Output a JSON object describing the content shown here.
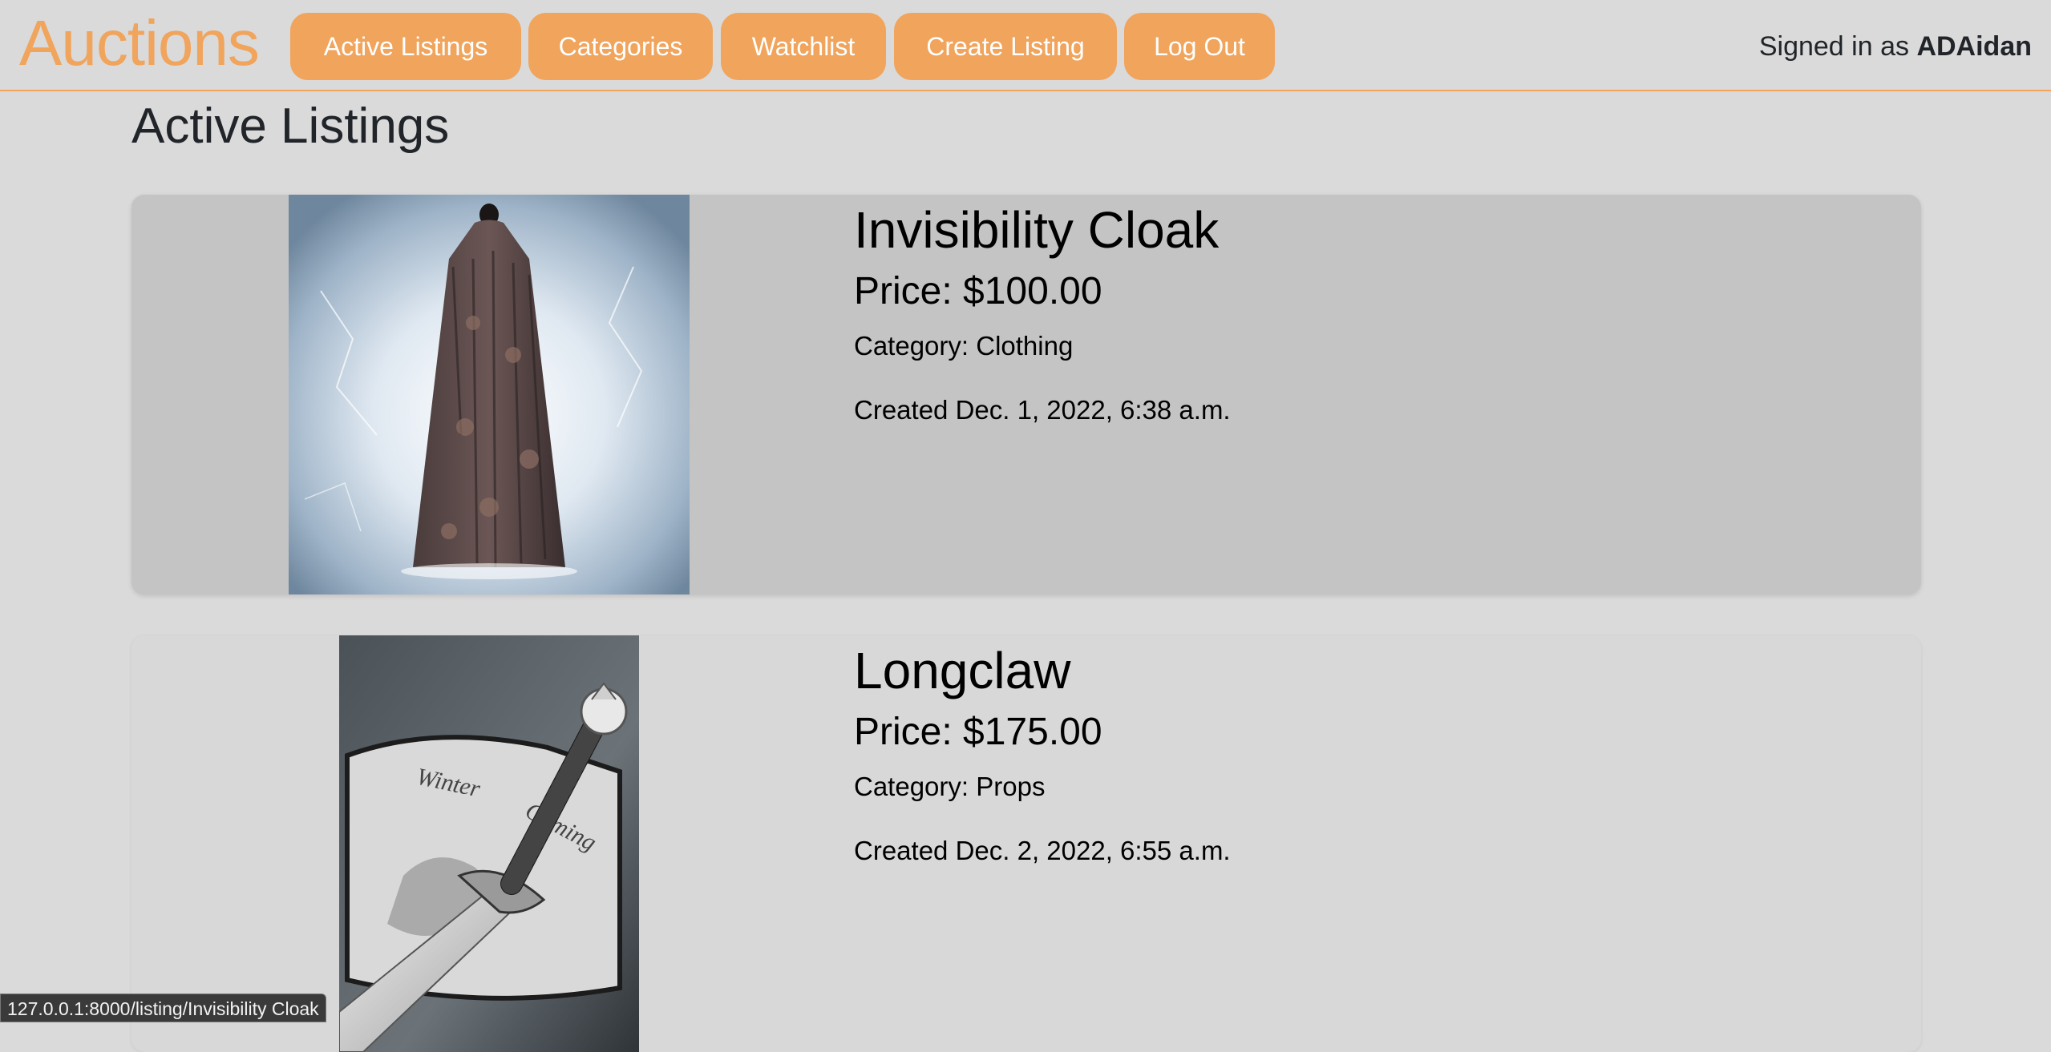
{
  "nav": {
    "brand": "Auctions",
    "links": [
      {
        "label": "Active Listings"
      },
      {
        "label": "Categories"
      },
      {
        "label": "Watchlist"
      },
      {
        "label": "Create Listing"
      },
      {
        "label": "Log Out"
      }
    ],
    "signed_in_prefix": "Signed in as",
    "username": "ADAidan"
  },
  "page": {
    "title": "Active Listings"
  },
  "listings": [
    {
      "title": "Invisibility Cloak",
      "price": "Price: $100.00",
      "category": "Category: Clothing",
      "created": "Created Dec. 1, 2022, 6:38 a.m.",
      "image_icon": "cloak-image"
    },
    {
      "title": "Longclaw",
      "price": "Price: $175.00",
      "category": "Category: Props",
      "created": "Created Dec. 2, 2022, 6:55 a.m.",
      "image_icon": "sword-image"
    }
  ],
  "status_bar": {
    "url": "127.0.0.1:8000/listing/Invisibility Cloak"
  },
  "colors": {
    "accent": "#f0a45c",
    "background": "#dadada",
    "card_hover": "#c4c4c4",
    "card": "#d8d8d8"
  }
}
